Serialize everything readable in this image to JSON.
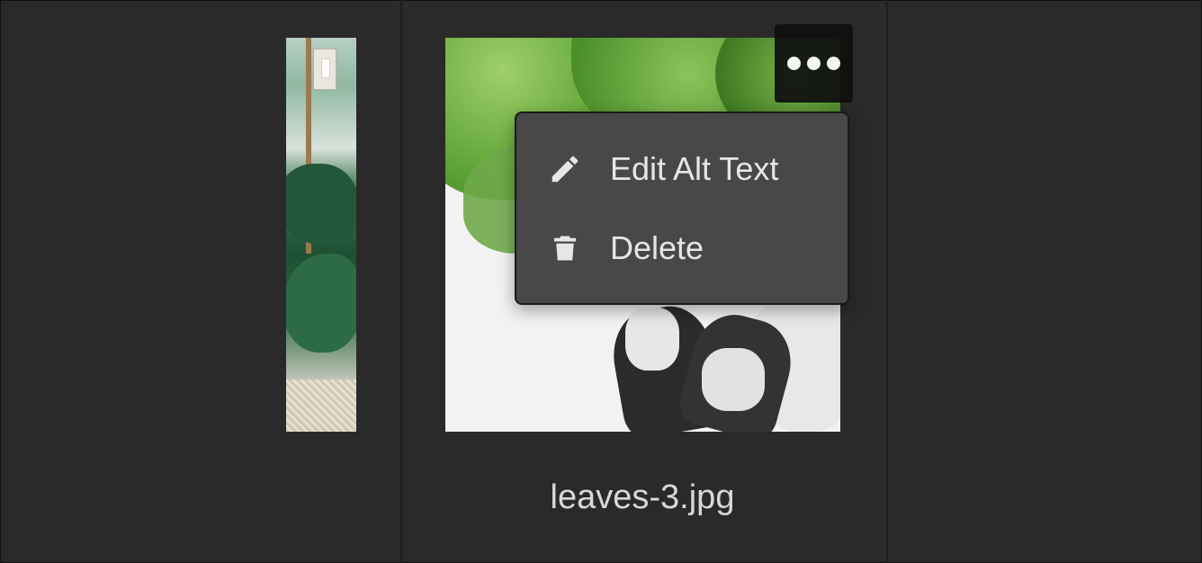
{
  "gallery": {
    "items": [
      {
        "name": "left-thumbnail"
      },
      {
        "name": "leaves-photo",
        "filename": "leaves-3.jpg"
      }
    ]
  },
  "more_button": {
    "icon": "ellipsis-horizontal-icon"
  },
  "context_menu": {
    "items": [
      {
        "icon": "pencil-icon",
        "label": "Edit Alt Text"
      },
      {
        "icon": "trash-icon",
        "label": "Delete"
      }
    ]
  },
  "colors": {
    "background": "#2a2a2a",
    "menu_background": "#484848",
    "menu_text": "#e6e6e6",
    "filename_text": "#d8d8d8"
  }
}
